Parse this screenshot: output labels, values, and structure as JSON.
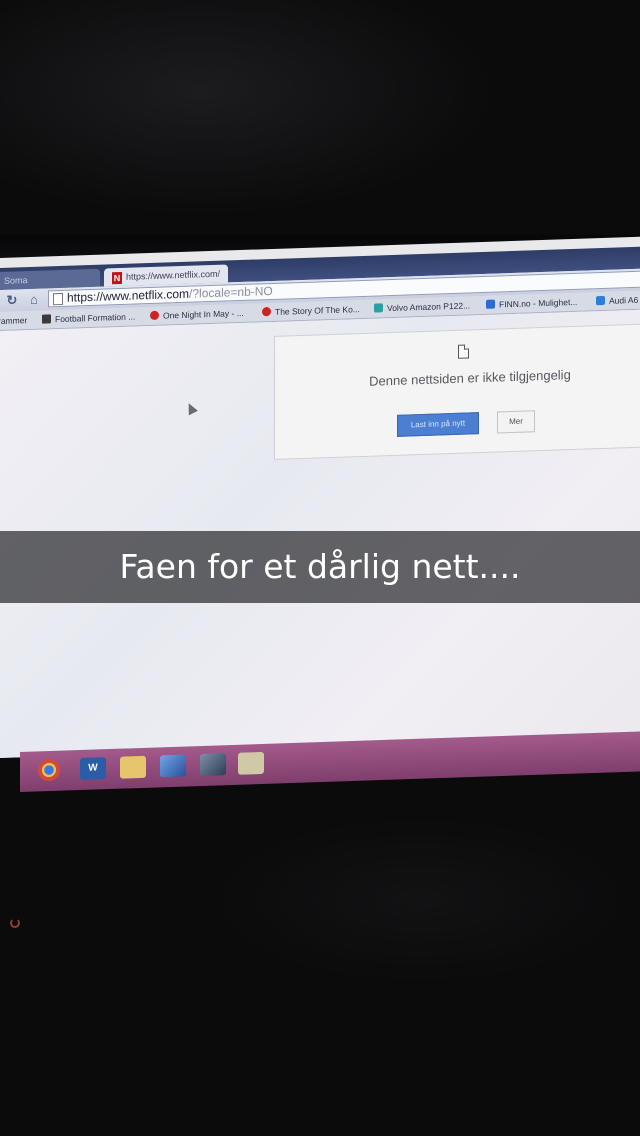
{
  "browser": {
    "tabs": [
      {
        "label": "Soma",
        "active": false
      },
      {
        "label": "https://www.netflix.com/",
        "active": true,
        "icon": "netflix-icon"
      }
    ],
    "address": {
      "host": "https://www.netflix.com",
      "rest": "/?locale=nb-NO"
    },
    "bookmarks": [
      {
        "label": "rammer",
        "icon": "none"
      },
      {
        "label": "Football Formation ...",
        "icon": "page-icon"
      },
      {
        "label": "One Night In May - ...",
        "icon": "youtube-icon"
      },
      {
        "label": "The Story Of The Ko...",
        "icon": "youtube-icon"
      },
      {
        "label": "Volvo Amazon P122...",
        "icon": "volvo-icon"
      },
      {
        "label": "FINN.no - Mulighet...",
        "icon": "finn-icon"
      },
      {
        "label": "Audi A6",
        "icon": "audi-icon"
      }
    ]
  },
  "error_page": {
    "message": "Denne nettsiden er ikke tilgjengelig",
    "reload_label": "Last inn på nytt",
    "more_label": "Mer"
  },
  "caption": "Faen for et dårlig nett....",
  "taskbar": {
    "apps": [
      "chrome-icon",
      "word-icon",
      "explorer-icon",
      "app-icon",
      "app-icon",
      "app-icon"
    ],
    "word_letter": "W"
  },
  "colors": {
    "tab_bar": "#2e3d66",
    "reload_button": "#4c7fd1",
    "taskbar": "#a35b8c",
    "caption_text": "#ffffff"
  }
}
